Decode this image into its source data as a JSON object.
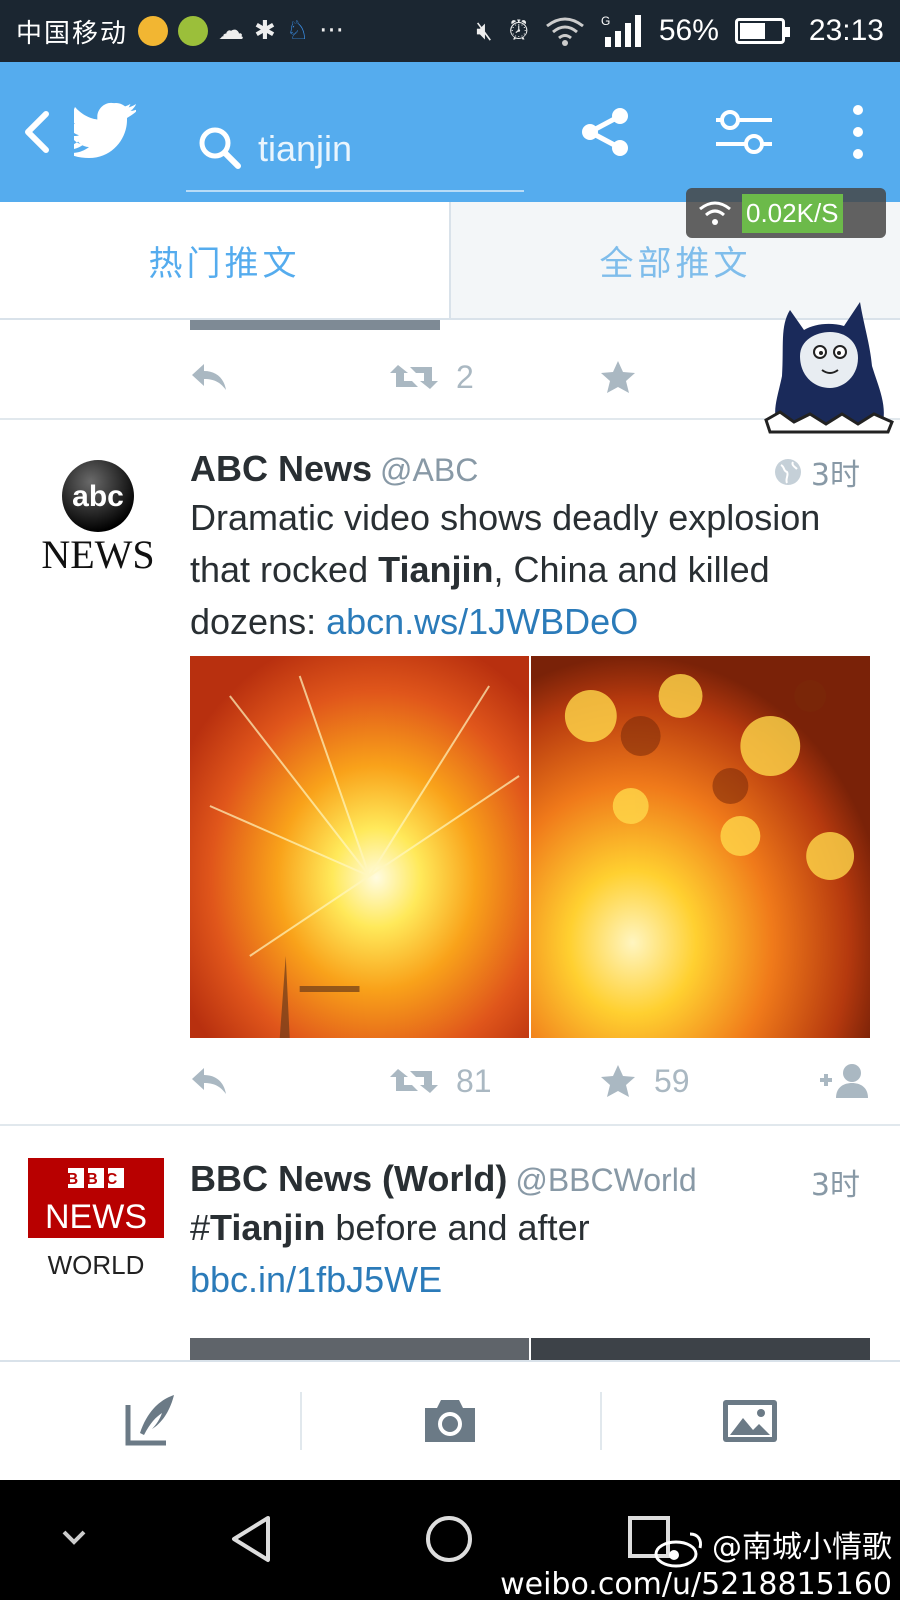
{
  "status_bar": {
    "carrier": "中国移动",
    "battery": "56%",
    "time": "23:13",
    "network_type": "G"
  },
  "app_bar": {
    "search_query": "tianjin",
    "accent_color": "#55acee"
  },
  "tabs": [
    {
      "label": "热门推文",
      "active": true
    },
    {
      "label": "全部推文",
      "active": false
    }
  ],
  "net_speed": "0.02K/S",
  "previous_tweet": {
    "retweets": "2"
  },
  "tweets": [
    {
      "name": "ABC News",
      "handle": "@ABC",
      "time": "3时",
      "avatar_line1": "abc",
      "avatar_line2": "NEWS",
      "text_before": "Dramatic video shows deadly explosion that rocked ",
      "text_bold": "Tianjin",
      "text_after": ", China and killed dozens: ",
      "link": "abcn.ws/1JWBDeO",
      "retweets": "81",
      "likes": "59"
    },
    {
      "name": "BBC News (World)",
      "handle": "@BBCWorld",
      "time": "3时",
      "avatar_line1": "BBC",
      "avatar_line2": "NEWS",
      "avatar_line3": "WORLD",
      "text_hash": "#",
      "text_bold": "Tianjin",
      "text_after": " before and after",
      "link": "bbc.in/1fbJ5WE"
    }
  ],
  "watermark": {
    "name": "@南城小情歌",
    "url": "weibo.com/u/5218815160"
  }
}
